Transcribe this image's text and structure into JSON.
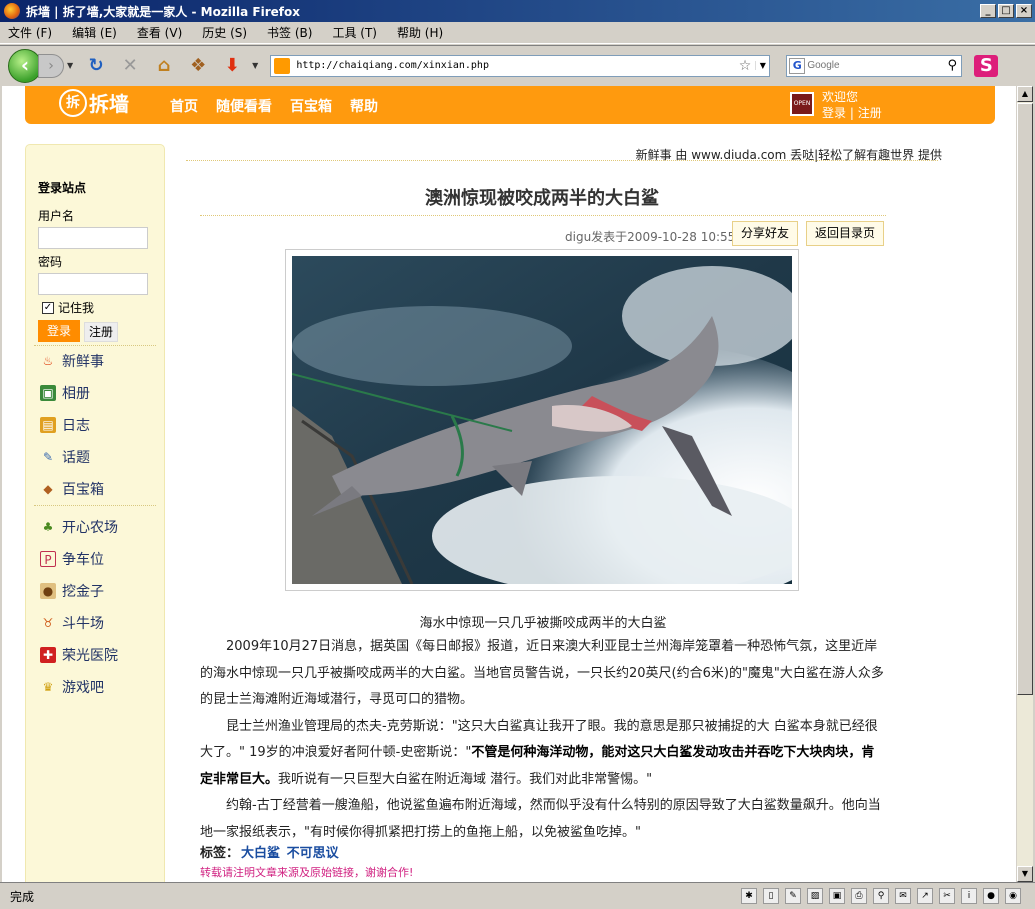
{
  "window": {
    "title": "拆墙 | 拆了墙,大家就是一家人 - Mozilla Firefox"
  },
  "menu": [
    "文件 (F)",
    "编辑 (E)",
    "查看 (V)",
    "历史 (S)",
    "书签 (B)",
    "工具 (T)",
    "帮助 (H)"
  ],
  "toolbar": {
    "url": "http://chaiqiang.com/xinxian.php",
    "search_placeholder": "Google",
    "search_engine_icon": "google-icon"
  },
  "site": {
    "logo": "拆墙",
    "nav": [
      "首页",
      "随便看看",
      "百宝箱",
      "帮助"
    ],
    "welcome": "欢迎您",
    "login_link": "登录",
    "register_link": "注册",
    "avatar_text": "OPEN"
  },
  "sidebar": {
    "title": "登录站点",
    "username_label": "用户名",
    "password_label": "密码",
    "remember_label": "记住我",
    "login_button": "登录",
    "register_button": "注册",
    "items": [
      {
        "label": "新鲜事",
        "icon": "fire-icon",
        "color": "#e04010"
      },
      {
        "label": "相册",
        "icon": "photo-icon",
        "color": "#3a8a3a"
      },
      {
        "label": "日志",
        "icon": "notebook-icon",
        "color": "#e0a020"
      },
      {
        "label": "话题",
        "icon": "chat-icon",
        "color": "#3a6ab0"
      },
      {
        "label": "百宝箱",
        "icon": "treasure-icon",
        "color": "#b06020"
      },
      {
        "label": "开心农场",
        "icon": "sprout-icon",
        "color": "#4a8a20"
      },
      {
        "label": "争车位",
        "icon": "parking-icon",
        "color": "#c03050"
      },
      {
        "label": "挖金子",
        "icon": "gold-icon",
        "color": "#c09040"
      },
      {
        "label": "斗牛场",
        "icon": "bull-icon",
        "color": "#d06020"
      },
      {
        "label": "荣光医院",
        "icon": "hospital-icon",
        "color": "#d02020"
      },
      {
        "label": "游戏吧",
        "icon": "trophy-icon",
        "color": "#d0a010"
      }
    ]
  },
  "article": {
    "source_line": "新鲜事 由 www.diuda.com 丢哒|轻松了解有趣世界 提供",
    "title": "澳洲惊现被咬成两半的大白鲨",
    "meta": "digu发表于2009-10-28 10:55",
    "share_button": "分享好友",
    "back_button": "返回目录页",
    "caption": "海水中惊现一只几乎被撕咬成两半的大白鲨",
    "para1": "2009年10月27日消息，据英国《每日邮报》报道，近日来澳大利亚昆士兰州海岸笼罩着一种恐怖气氛，这里近岸的海水中惊现一只几乎被撕咬成两半的大白鲨。当地官员警告说，一只长约20英尺(约合6米)的\"魔鬼\"大白鲨在游人众多的昆士兰海滩附近海域潜行，寻觅可口的猎物。",
    "para2_a": "昆士兰州渔业管理局的杰夫-克劳斯说：\"这只大白鲨真让我开了眼。我的意思是那只被捕捉的大 白鲨本身就已经很大了。\" 19岁的冲浪爱好者阿什顿-史密斯说：\"",
    "para2_b": "不管是何种海洋动物，能对这只大白鲨发动攻击并吞吃下大块肉块，肯定非常巨大。",
    "para2_c": "我听说有一只巨型大白鲨在附近海域 潜行。我们对此非常警惕。\"",
    "para3": "约翰-古丁经营着一艘渔船，他说鲨鱼遍布附近海域，然而似乎没有什么特别的原因导致了大白鲨数量飙升。他向当地一家报纸表示，\"有时候你得抓紧把打捞上的鱼拖上船，以免被鲨鱼吃掉。\"",
    "tags_label": "标签：",
    "tags": [
      "大白鲨",
      "不可思议"
    ],
    "repost_notice": "转载请注明文章来源及原始链接，谢谢合作!"
  },
  "status": {
    "text": "完成"
  }
}
